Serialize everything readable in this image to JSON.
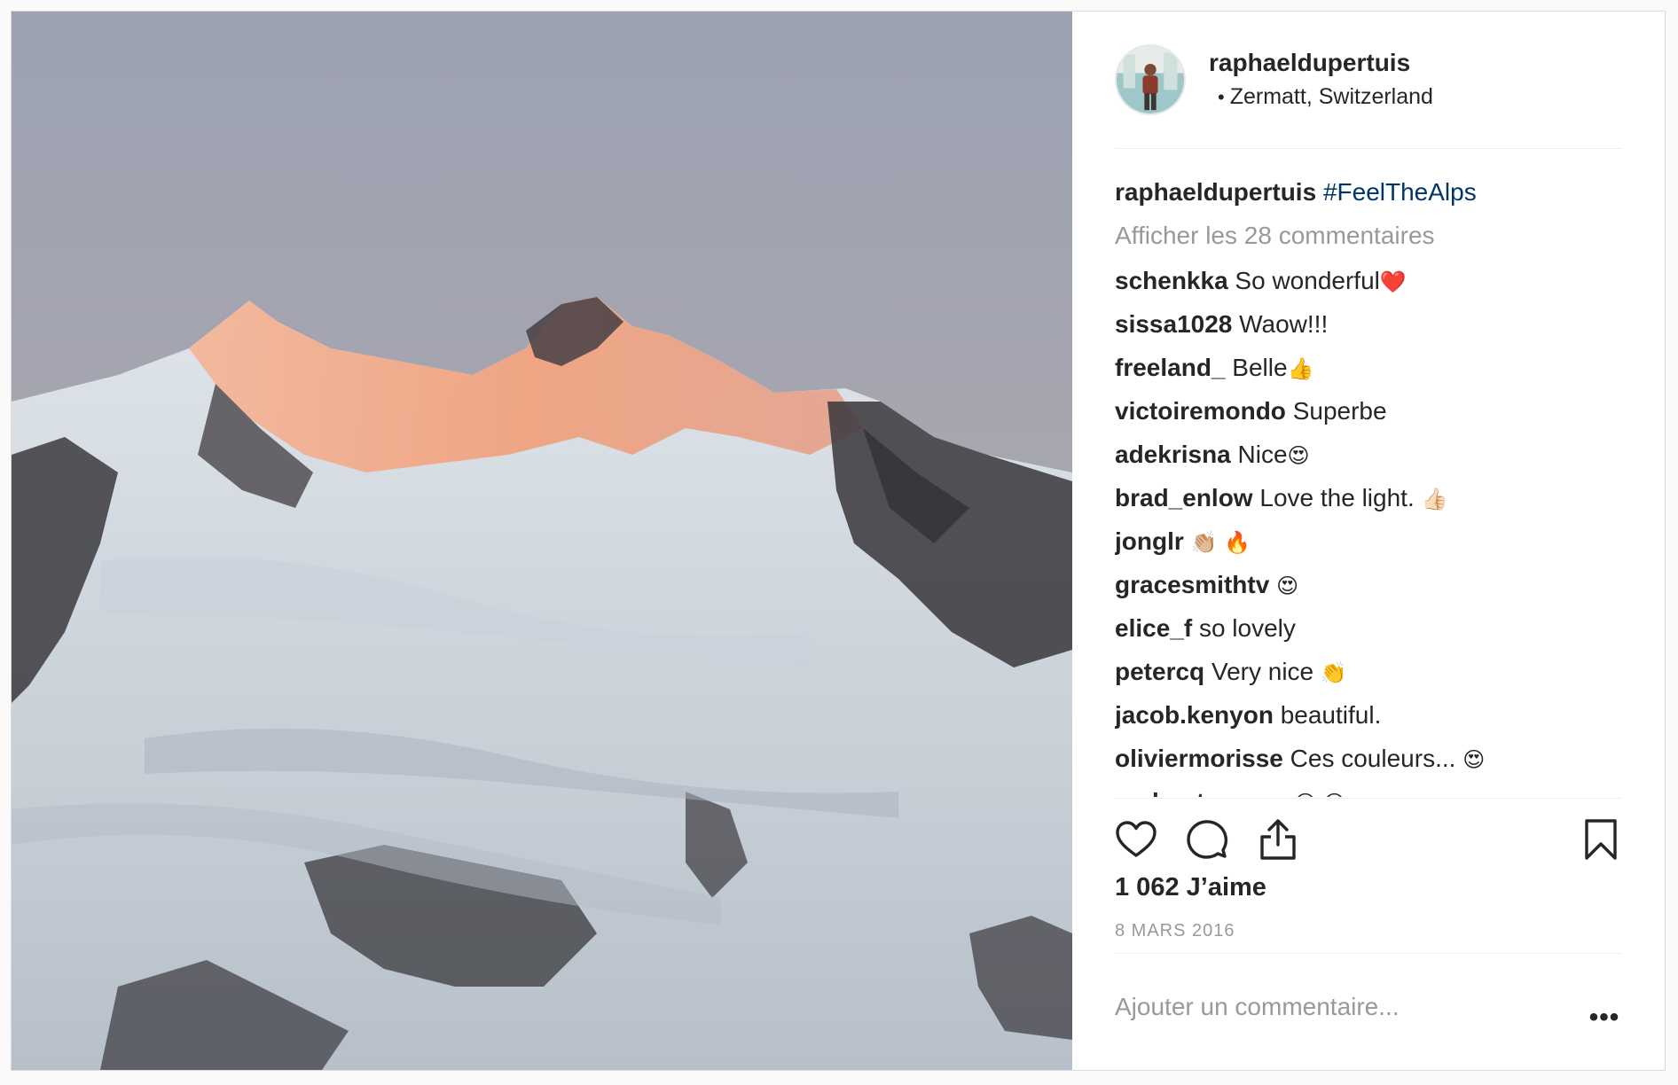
{
  "post": {
    "author": "raphaeldupertuis",
    "location": "Zermatt, Switzerland",
    "location_dot": "•",
    "caption_user": "raphaeldupertuis",
    "caption_text": "#FeelTheAlps",
    "view_all_comments": "Afficher les 28 commentaires",
    "likes": "1 062 J’aime",
    "date": "8 MARS 2016",
    "add_comment_placeholder": "Ajouter un commentaire...",
    "more_label": "•••",
    "photo_icon": "mountain-photo",
    "avatar_icon": "person-avatar"
  },
  "comments": [
    {
      "user": "schenkka",
      "text": "So wonderful",
      "emoji": "❤️"
    },
    {
      "user": "sissa1028",
      "text": "Waow!!!",
      "emoji": ""
    },
    {
      "user": "freeland_",
      "text": "Belle",
      "emoji": "👍"
    },
    {
      "user": "victoiremondo",
      "text": "Superbe",
      "emoji": ""
    },
    {
      "user": "adekrisna",
      "text": "Nice",
      "emoji": "😍"
    },
    {
      "user": "brad_enlow",
      "text": "Love the light.",
      "emoji": "👍🏻"
    },
    {
      "user": "jonglr",
      "text": "",
      "emoji": "👏🏼 🔥"
    },
    {
      "user": "gracesmithtv",
      "text": "",
      "emoji": "😍"
    },
    {
      "user": "elice_f",
      "text": "so lovely",
      "emoji": ""
    },
    {
      "user": "petercq",
      "text": "Very nice",
      "emoji": "👏"
    },
    {
      "user": "jacob.kenyon",
      "text": "beautiful.",
      "emoji": ""
    },
    {
      "user": "oliviermorisse",
      "text": "Ces couleurs...",
      "emoji": "😍"
    },
    {
      "user": "andrestummer",
      "text": "",
      "emoji": "😍 😍"
    }
  ],
  "actions": {
    "like_icon": "heart-icon",
    "comment_icon": "comment-bubble-icon",
    "share_icon": "share-icon",
    "save_icon": "bookmark-icon"
  },
  "colors": {
    "text": "#262626",
    "muted": "#999999",
    "hashtag": "#003569",
    "border": "#dbdbdb"
  }
}
